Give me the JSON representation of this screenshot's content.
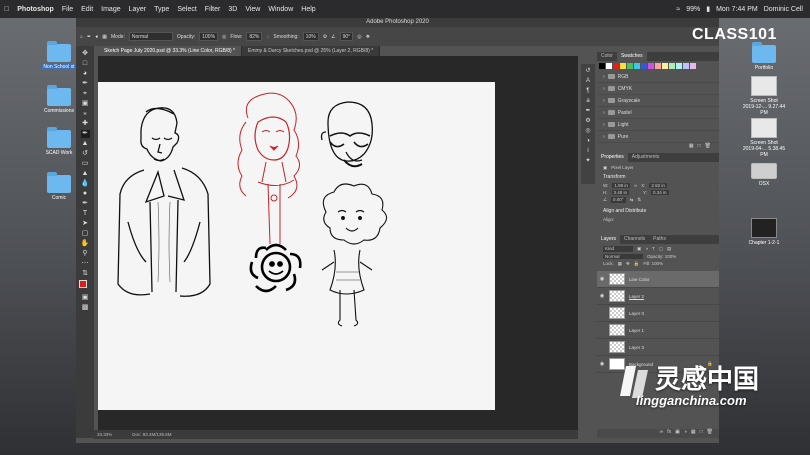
{
  "menubar": {
    "apple_icon": "apple-icon",
    "items": [
      "Photoshop",
      "File",
      "Edit",
      "Image",
      "Layer",
      "Type",
      "Select",
      "Filter",
      "3D",
      "View",
      "Window",
      "Help"
    ],
    "battery": "99%",
    "clock": "Mon 7:44 PM",
    "user": "Dominic Cell"
  },
  "watermark": {
    "class101": "CLASS101",
    "cn_text": "灵感中国",
    "site": "lingganchina.com"
  },
  "desktop_left": [
    {
      "label": "Non School st",
      "kind": "folder",
      "selected": true
    },
    {
      "label": "Commissions",
      "kind": "folder"
    },
    {
      "label": "SCAD Work",
      "kind": "folder"
    },
    {
      "label": "Comic",
      "kind": "folder"
    }
  ],
  "desktop_right": [
    {
      "label": "Portfolio",
      "kind": "folder"
    },
    {
      "label": "Screen Shot\n2019-12-... 9.27.44 PM",
      "kind": "doc"
    },
    {
      "label": "Screen Shot\n2019-04-... 5.38.45 PM",
      "kind": "doc"
    },
    {
      "label": "OSX",
      "kind": "drive"
    },
    {
      "label": "Chapter 1-2-1",
      "kind": "doc"
    }
  ],
  "photoshop": {
    "window_title": "Adobe Photoshop 2020",
    "options": {
      "mode_label": "Mode:",
      "mode_value": "Normal",
      "opacity_label": "Opacity:",
      "opacity_value": "100%",
      "flow_label": "Flow:",
      "flow_value": "82%",
      "smoothing_label": "Smoothing:",
      "smoothing_value": "10%",
      "angle_value": "90°"
    },
    "tabs": [
      {
        "label": "Sketch Page July 2020.psd @ 33.3% (Line Color, RGB/8) *",
        "active": true
      },
      {
        "label": "Emmy & Darcy Sketches.psd @ 25% (Layer 2, RGB/8) *",
        "active": false
      }
    ],
    "status": {
      "zoom": "33.33%",
      "doc": "Doc: 83.4M/135.6M"
    }
  },
  "panels": {
    "top_tabs": [
      "Color",
      "Swatches"
    ],
    "swatch_colors": [
      "#000000",
      "#ffffff",
      "#e02020",
      "#f5e23a",
      "#4dbf5a",
      "#3fc6e8",
      "#2f5bd6",
      "#d64fd6",
      "#f7a6a6",
      "#f8f0a0",
      "#b0f0b0",
      "#b0f0f8",
      "#b8c6f8",
      "#e6b8f0"
    ],
    "groups": [
      "RGB",
      "CMYK",
      "Grayscale",
      "Pastel",
      "Light",
      "Pure"
    ],
    "properties": {
      "tabs": [
        "Properties",
        "Adjustments"
      ],
      "layer_type": "Pixel Layer",
      "transform_title": "Transform",
      "w": "1.89 in",
      "x": "2.92 in",
      "h": "3.48 in",
      "y": "0.34 in",
      "angle": "0.00°",
      "align_title": "Align and Distribute",
      "align_sub": "Align:"
    },
    "layers": {
      "tabs": [
        "Layers",
        "Channels",
        "Paths"
      ],
      "kind": "Kind",
      "blend": "Normal",
      "opacity": "Opacity: 100%",
      "lock": "Lock:",
      "fill": "Fill: 100%",
      "items": [
        {
          "name": "Line Color",
          "selected": true
        },
        {
          "name": "Layer 2",
          "selected": false
        },
        {
          "name": "Layer 0",
          "selected": false
        },
        {
          "name": "Layer 1",
          "selected": false
        },
        {
          "name": "Layer 3",
          "selected": false
        },
        {
          "name": "Background",
          "selected": false
        }
      ]
    }
  }
}
